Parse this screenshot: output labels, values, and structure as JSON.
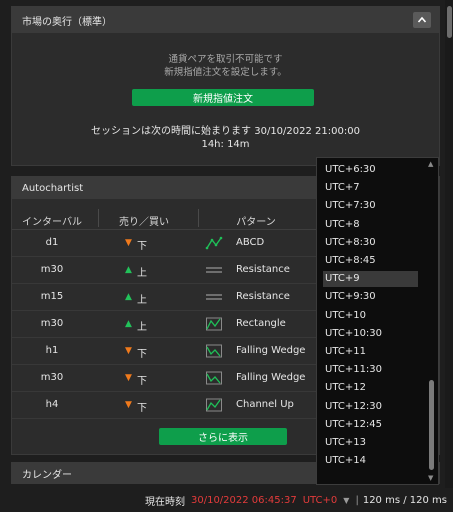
{
  "market_panel": {
    "title": "市場の奥行（標準）",
    "message_line1": "通貨ペアを取引不可能です",
    "message_line2": "新規指値注文を設定します。",
    "new_limit_order_label": "新規指値注文",
    "session_text": "セッションは次の時間に始まります 30/10/2022 21:00:00",
    "countdown": "14h: 14m"
  },
  "autochartist": {
    "title": "Autochartist",
    "headers": {
      "interval": "インターバル",
      "side": "売り／買い",
      "pattern": "パターン"
    },
    "rows": [
      {
        "interval": "d1",
        "direction": "down",
        "side": "下",
        "pattern": "ABCD",
        "icon": "abcd-pattern-icon"
      },
      {
        "interval": "m30",
        "direction": "up",
        "side": "上",
        "pattern": "Resistance",
        "icon": "resistance-icon"
      },
      {
        "interval": "m15",
        "direction": "up",
        "side": "上",
        "pattern": "Resistance",
        "icon": "resistance-icon"
      },
      {
        "interval": "m30",
        "direction": "up",
        "side": "上",
        "pattern": "Rectangle",
        "icon": "rectangle-pattern-icon"
      },
      {
        "interval": "h1",
        "direction": "down",
        "side": "下",
        "pattern": "Falling Wedge",
        "icon": "falling-wedge-icon"
      },
      {
        "interval": "m30",
        "direction": "down",
        "side": "下",
        "pattern": "Falling Wedge",
        "icon": "falling-wedge-icon"
      },
      {
        "interval": "h4",
        "direction": "down",
        "side": "下",
        "pattern": "Channel Up",
        "icon": "channel-up-icon"
      }
    ],
    "show_more_label": "さらに表示"
  },
  "calendar": {
    "title": "カレンダー"
  },
  "status_bar": {
    "current_time_label": "現在時刻",
    "current_time": "30/10/2022 06:45:37",
    "timezone": "UTC+0",
    "latency": "120 ms / 120 ms"
  },
  "timezone_dropdown": {
    "options": [
      "UTC+6:30",
      "UTC+7",
      "UTC+7:30",
      "UTC+8",
      "UTC+8:30",
      "UTC+8:45",
      "UTC+9",
      "UTC+9:30",
      "UTC+10",
      "UTC+10:30",
      "UTC+11",
      "UTC+11:30",
      "UTC+12",
      "UTC+12:30",
      "UTC+12:45",
      "UTC+13",
      "UTC+14"
    ],
    "highlighted": "UTC+9"
  },
  "colors": {
    "accent_green": "#0e9e4b",
    "down_orange": "#f07a1c",
    "up_green": "#22c25a",
    "time_red": "#e33b3b"
  }
}
